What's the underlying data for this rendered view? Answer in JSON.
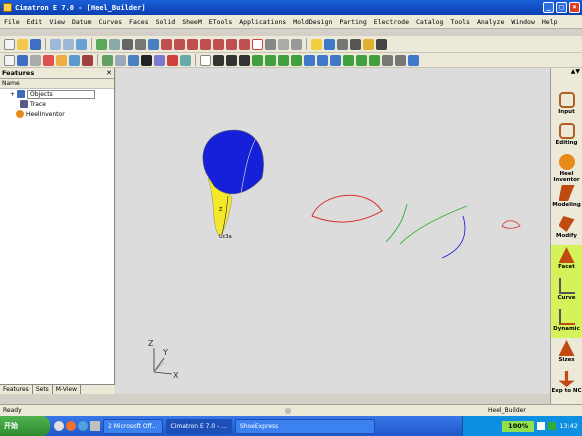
{
  "window": {
    "title": "Cimatron E 7.0 - [Heel_Builder]"
  },
  "menu": [
    "File",
    "Edit",
    "View",
    "Datum",
    "Curves",
    "Faces",
    "Solid",
    "SheeM",
    "ETools",
    "Applications",
    "MoldDesign",
    "Parting",
    "Electrode",
    "Catalog",
    "Tools",
    "Analyze",
    "Window",
    "Help"
  ],
  "panel": {
    "title": "Features",
    "column": "Name",
    "tree": [
      {
        "label": "Objects",
        "icon_color": "#3c6fb8"
      },
      {
        "label": "Trace",
        "icon_color": "#3c6fb8"
      },
      {
        "label": "HeelInventor",
        "icon_color": "#e88a1a"
      }
    ],
    "tabs": [
      "Features",
      "Sets",
      "M-View"
    ]
  },
  "rightbar": [
    {
      "label": "Input",
      "hl": false
    },
    {
      "label": "Editing",
      "hl": false
    },
    {
      "label": "Heel Inventor",
      "hl": false
    },
    {
      "label": "Modeling",
      "hl": false
    },
    {
      "label": "Modify",
      "hl": false
    },
    {
      "label": "Facet",
      "hl": true
    },
    {
      "label": "Curve",
      "hl": true
    },
    {
      "label": "Dynamic",
      "hl": true
    },
    {
      "label": "Sizes",
      "hl": false
    },
    {
      "label": "Exp to NC",
      "hl": false
    }
  ],
  "axes": {
    "x": "X",
    "y": "Y",
    "z": "Z"
  },
  "status": {
    "left": "Ready",
    "right": "Heel_Builder"
  },
  "taskbar": {
    "start": "开始",
    "tasks": [
      "2 Microsoft Off...",
      "Cimatron E 7.0 - ...",
      "ShoeExpress"
    ],
    "zoom": "100%",
    "time": "13:42"
  },
  "colors": {
    "accent": "#0b3fb0",
    "highlight": "#d6f25a"
  }
}
